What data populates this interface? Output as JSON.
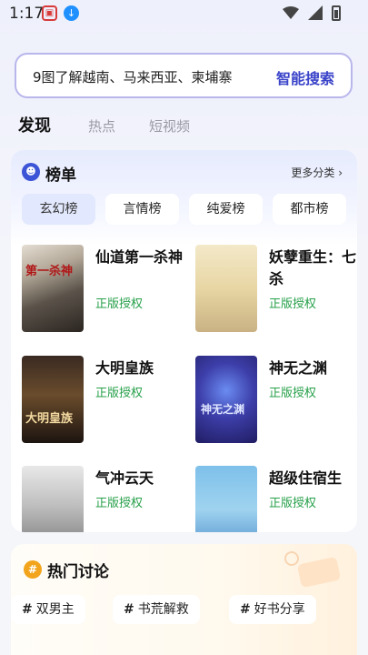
{
  "status": {
    "time": "1:17"
  },
  "search": {
    "query": "9图了解越南、马来西亚、柬埔寨",
    "button": "智能搜索"
  },
  "tabs": [
    {
      "label": "发现"
    },
    {
      "label": "热点"
    },
    {
      "label": "短视频"
    }
  ],
  "ranking": {
    "title": "榜单",
    "more": "更多分类",
    "chips": [
      {
        "label": "玄幻榜"
      },
      {
        "label": "言情榜"
      },
      {
        "label": "纯爱榜"
      },
      {
        "label": "都市榜"
      }
    ],
    "books": [
      {
        "title": "仙道第一杀神",
        "tag": "正版授权"
      },
      {
        "title": "妖孽重生：七杀",
        "tag": "正版授权"
      },
      {
        "title": "大明皇族",
        "tag": "正版授权"
      },
      {
        "title": "神无之渊",
        "tag": "正版授权"
      },
      {
        "title": "气冲云天",
        "tag": "正版授权"
      },
      {
        "title": "超级住宿生",
        "tag": "正版授权"
      }
    ],
    "covers": [
      "第一杀神",
      "",
      "大明皇族",
      "神无之渊",
      "",
      ""
    ]
  },
  "discussion": {
    "title": "热门讨论",
    "topics": [
      {
        "label": "双男主"
      },
      {
        "label": "书荒解救"
      },
      {
        "label": "好书分享"
      }
    ]
  },
  "colors": {
    "accent": "#3b44c9",
    "license_green": "#27a04a",
    "rank_icon": "#3c54d6",
    "discussion_icon": "#f2a51c"
  }
}
